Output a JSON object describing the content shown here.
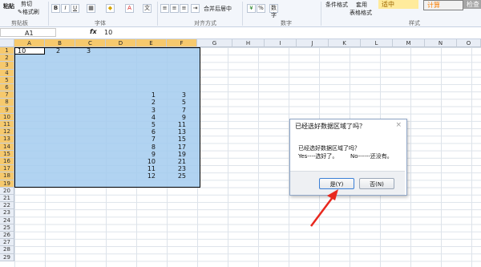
{
  "ribbon": {
    "clipboard": {
      "paste": "粘贴",
      "cut": "剪切",
      "format_painter": "格式刷",
      "group": "剪贴板"
    },
    "font": {
      "bold": "B",
      "italic": "I",
      "underline": "U",
      "group": "字体"
    },
    "alignment": {
      "merge_center": "合并后居中",
      "group": "对齐方式"
    },
    "number": {
      "format": "数字",
      "percent": "%",
      "group": "数字"
    },
    "styles": {
      "conditional": "条件格式",
      "table_format": "套用",
      "table_format2": "表格格式",
      "style_normal": "适中",
      "style_calc": "计算",
      "style_check": "检查",
      "group": "样式"
    }
  },
  "formula_bar": {
    "name_box": "A1",
    "fx": "fx",
    "value": "10"
  },
  "columns": [
    "A",
    "B",
    "C",
    "D",
    "E",
    "F",
    "G",
    "H",
    "I",
    "J",
    "K",
    "L",
    "M",
    "N",
    "O"
  ],
  "selected_columns": [
    "A",
    "B",
    "C",
    "D",
    "E",
    "F"
  ],
  "rows": [
    "1",
    "2",
    "3",
    "4",
    "5",
    "6",
    "7",
    "8",
    "9",
    "10",
    "11",
    "12",
    "13",
    "14",
    "15",
    "16",
    "17",
    "18",
    "19",
    "20",
    "21",
    "22",
    "23",
    "24",
    "25",
    "26",
    "27",
    "28",
    "29"
  ],
  "cells": {
    "A1": "10",
    "B1": "2",
    "C1": "3",
    "E": [
      "1",
      "2",
      "3",
      "4",
      "5",
      "6",
      "7",
      "8",
      "9",
      "10",
      "11",
      "12"
    ],
    "F": [
      "3",
      "5",
      "7",
      "9",
      "11",
      "13",
      "15",
      "17",
      "19",
      "21",
      "23",
      "25"
    ]
  },
  "dialog": {
    "title": "已经选好数据区域了吗？",
    "close": "×",
    "message": "已经选好数据区域了吗？",
    "detail": "Yes----选好了。       No------还没有。",
    "yes_button": "是(Y)",
    "no_button": "否(N)"
  },
  "colors": {
    "selection": "#a3cbee",
    "header_selected": "#f6c96d",
    "arrow": "#e8281e"
  }
}
